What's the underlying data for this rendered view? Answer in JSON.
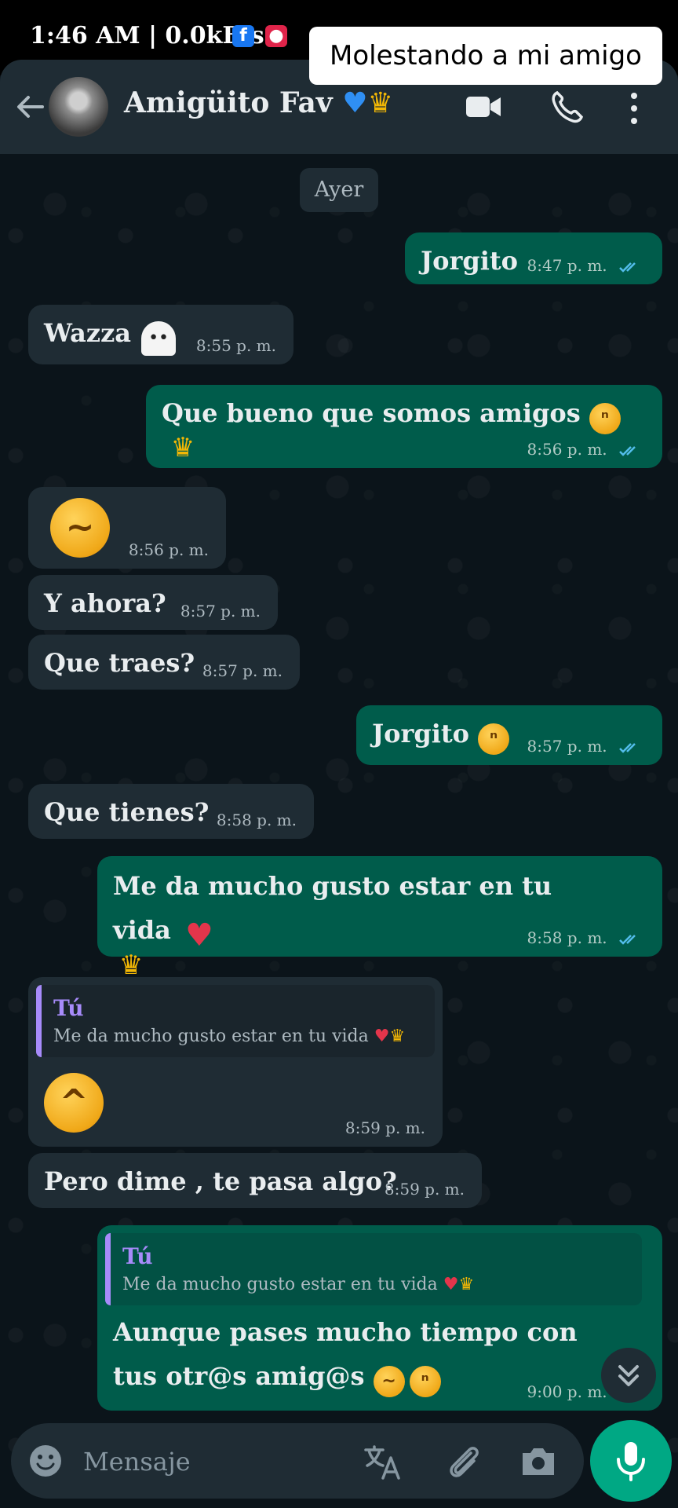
{
  "status_bar": {
    "time": "1:46 AM | 0.0kB/s",
    "fb_glyph": "f",
    "rec_glyph": "●"
  },
  "overlay_caption": "Molestando a mi amigo",
  "header": {
    "contact_name": "Amigüito Fav",
    "contact_emoji": "💙👑"
  },
  "chat": {
    "date_chip": "Ayer",
    "messages": [
      {
        "dir": "out",
        "text": "Jorgito",
        "time": "8:47 p. m.",
        "status": "read"
      },
      {
        "dir": "in",
        "text": "Wazza",
        "emoji": "ghost-emoji",
        "time": "8:55 p. m."
      },
      {
        "dir": "out",
        "text": "Que bueno que somos amigos",
        "emoji": "pleading-face-emoji, crown-emoji",
        "time": "8:56 p. m.",
        "status": "read"
      },
      {
        "dir": "in",
        "text": "",
        "emoji": "confused-face-emoji",
        "time": "8:56 p. m."
      },
      {
        "dir": "in",
        "text": "Y ahora?",
        "time": "8:57 p. m."
      },
      {
        "dir": "in",
        "text": "Que traes?",
        "time": "8:57 p. m."
      },
      {
        "dir": "out",
        "text": "Jorgito",
        "emoji": "pleading-face-emoji",
        "time": "8:57 p. m.",
        "status": "read"
      },
      {
        "dir": "in",
        "text": "Que tienes?",
        "time": "8:58 p. m."
      },
      {
        "dir": "out",
        "text": "Me da mucho gusto estar en tu vida",
        "emoji": "mending-heart-emoji, crown-emoji",
        "time": "8:58 p. m.",
        "status": "read"
      },
      {
        "dir": "in",
        "reply_author": "Tú",
        "reply_text": "Me da mucho gusto estar en tu vida",
        "text": "",
        "emoji": "hugging-face-emoji",
        "time": "8:59 p. m."
      },
      {
        "dir": "in",
        "text": "Pero dime , te pasa algo?",
        "time": "8:59 p. m."
      },
      {
        "dir": "out",
        "reply_author": "Tú",
        "reply_text": "Me da mucho gusto estar en tu vida",
        "text": "Aunque pases mucho tiempo con tus otr@s amig@s",
        "emoji": "downcast-sweat-emoji, pleading-face-emoji",
        "time": "9:00 p. m.",
        "status": "read"
      }
    ]
  },
  "input_bar": {
    "placeholder": "Mensaje"
  },
  "colors": {
    "background": "#0b141a",
    "header": "#1f2c34",
    "incoming_bubble": "#1f2c34",
    "outgoing_bubble": "#005c4b",
    "accent": "#00a884",
    "read_ticks": "#53bdeb",
    "quote_bar": "#a78bfa"
  }
}
